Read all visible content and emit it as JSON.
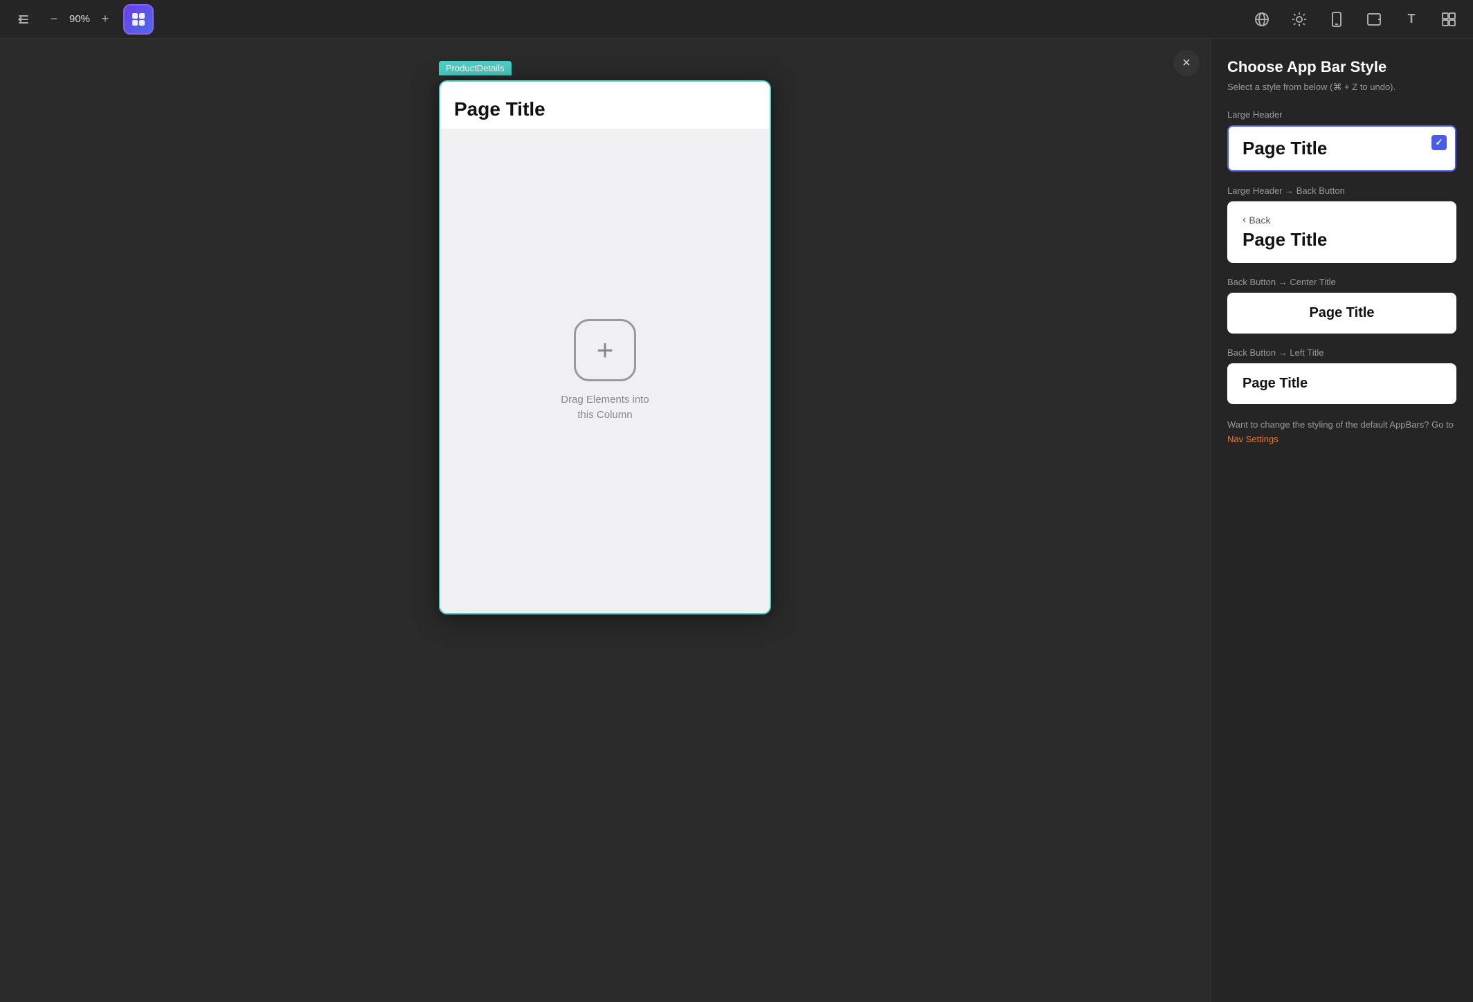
{
  "toolbar": {
    "collapse_icon": "◀",
    "zoom_minus": "−",
    "zoom_level": "90%",
    "zoom_plus": "+",
    "active_tool_label": "components-tool",
    "globe_icon": "🌐",
    "sun_icon": "☀",
    "phone_icon": "📱",
    "tablet_icon": "▣",
    "text_icon": "T",
    "grid_icon": "⊞"
  },
  "canvas": {
    "product_details_tag": "ProductDetails",
    "page_title": "Page Title",
    "drag_text_line1": "Drag Elements into",
    "drag_text_line2": "this Column"
  },
  "panel": {
    "close_icon": "✕",
    "title": "Choose App Bar Style",
    "subtitle": "Select a style from below (⌘ + Z to undo).",
    "styles": [
      {
        "id": "large-header",
        "label": "Large Header",
        "selected": true,
        "show_back": false,
        "back_text": "",
        "title_text": "Page Title",
        "title_align": "left",
        "title_size": "large"
      },
      {
        "id": "large-header-back",
        "label": "Large Header → Back Button",
        "selected": false,
        "show_back": true,
        "back_text": "Back",
        "title_text": "Page Title",
        "title_align": "left",
        "title_size": "large"
      },
      {
        "id": "back-center-title",
        "label": "Back Button → Center Title",
        "selected": false,
        "show_back": false,
        "back_text": "",
        "title_text": "Page Title",
        "title_align": "center",
        "title_size": "medium"
      },
      {
        "id": "back-left-title",
        "label": "Back Button → Left Title",
        "selected": false,
        "show_back": false,
        "back_text": "",
        "title_text": "Page Title",
        "title_align": "left",
        "title_size": "medium"
      }
    ],
    "footer_text_before_link": "Want to change the styling of the default AppBars? Go to ",
    "footer_link_text": "Nav Settings",
    "footer_text_after_link": ""
  }
}
